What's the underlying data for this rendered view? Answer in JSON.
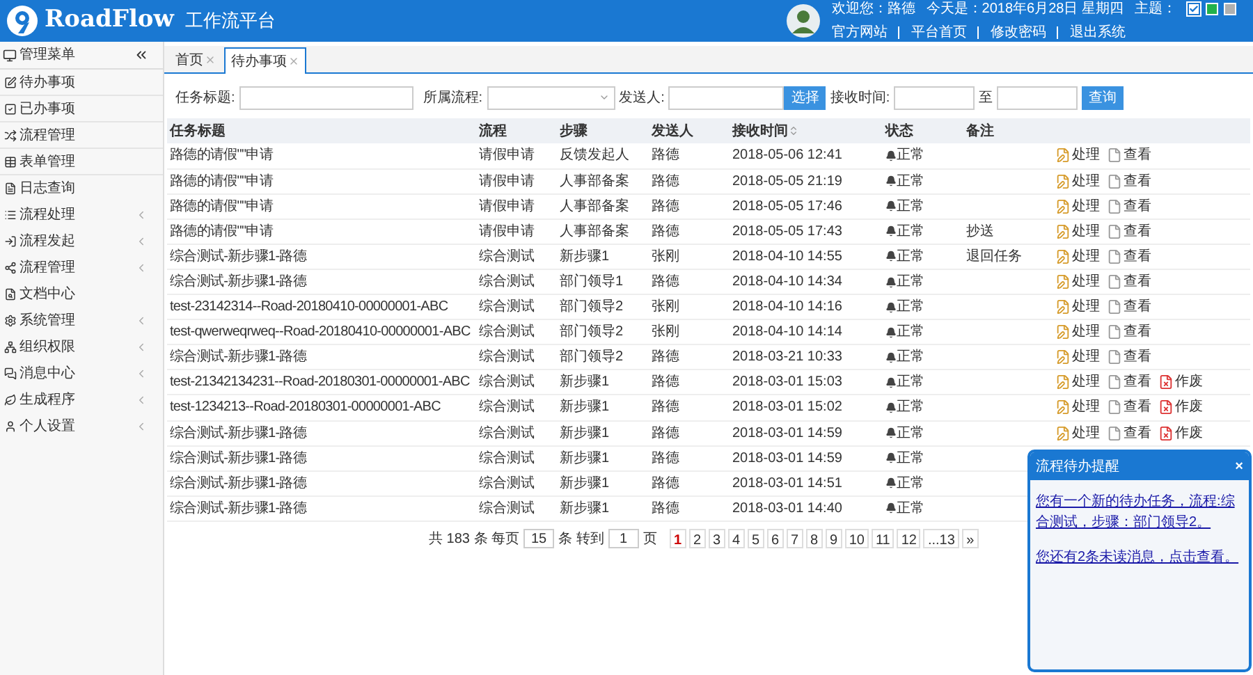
{
  "header": {
    "brand": "RoadFlow",
    "subtitle": "工作流平台",
    "welcome": "欢迎您：路德",
    "today": "今天是：2018年6月28日 星期四",
    "theme_label": "主题：",
    "themes": [
      {
        "color": "#ffffff",
        "selected": true
      },
      {
        "color": "#22b14c",
        "selected": false
      },
      {
        "color": "#b0b0b0",
        "selected": false
      }
    ],
    "links": [
      "官方网站",
      "平台首页",
      "修改密码",
      "退出系统"
    ]
  },
  "sidebar": {
    "title": "管理菜单",
    "items": [
      {
        "label": "待办事项",
        "expandable": false
      },
      {
        "label": "已办事项",
        "expandable": false
      },
      {
        "label": "流程管理",
        "expandable": false
      },
      {
        "label": "表单管理",
        "expandable": false
      },
      {
        "label": "日志查询",
        "expandable": false
      },
      {
        "label": "流程处理",
        "expandable": true
      },
      {
        "label": "流程发起",
        "expandable": true
      },
      {
        "label": "流程管理",
        "expandable": true
      },
      {
        "label": "文档中心",
        "expandable": false
      },
      {
        "label": "系统管理",
        "expandable": true
      },
      {
        "label": "组织权限",
        "expandable": true
      },
      {
        "label": "消息中心",
        "expandable": true
      },
      {
        "label": "生成程序",
        "expandable": true
      },
      {
        "label": "个人设置",
        "expandable": true
      }
    ]
  },
  "tabs": [
    {
      "label": "首页",
      "selected": false
    },
    {
      "label": "待办事项",
      "selected": true
    }
  ],
  "filters": {
    "title_label": "任务标题:",
    "flow_label": "所属流程:",
    "sender_label": "发送人:",
    "select_button": "选择",
    "time_label": "接收时间:",
    "to_label": "至",
    "query_button": "查询"
  },
  "table": {
    "columns": [
      "任务标题",
      "流程",
      "步骤",
      "发送人",
      "接收时间",
      "状态",
      "备注"
    ],
    "rows": [
      {
        "title": "路德的请假\"\"申请",
        "flow": "请假申请",
        "step": "反馈发起人",
        "sender": "路德",
        "time": "2018-05-06 12:41",
        "status": "正常",
        "actions": [
          {
            "kind": "process",
            "label": "处理"
          },
          {
            "kind": "view",
            "label": "查看"
          }
        ]
      },
      {
        "title": "路德的请假\"\"申请",
        "flow": "请假申请",
        "step": "人事部备案",
        "sender": "路德",
        "time": "2018-05-05 21:19",
        "status": "正常",
        "actions": [
          {
            "kind": "process",
            "label": "处理"
          },
          {
            "kind": "view",
            "label": "查看"
          }
        ]
      },
      {
        "title": "路德的请假\"\"申请",
        "flow": "请假申请",
        "step": "人事部备案",
        "sender": "路德",
        "time": "2018-05-05 17:46",
        "status": "正常",
        "actions": [
          {
            "kind": "process",
            "label": "处理"
          },
          {
            "kind": "view",
            "label": "查看"
          }
        ]
      },
      {
        "title": "路德的请假\"\"申请",
        "flow": "请假申请",
        "step": "人事部备案",
        "sender": "路德",
        "time": "2018-05-05 17:43",
        "status": "正常",
        "note": "抄送",
        "actions": [
          {
            "kind": "process",
            "label": "处理"
          },
          {
            "kind": "view",
            "label": "查看"
          }
        ]
      },
      {
        "title": "综合测试-新步骤1-路德",
        "flow": "综合测试",
        "step": "新步骤1",
        "sender": "张刚",
        "time": "2018-04-10 14:55",
        "status": "正常",
        "note": "退回任务",
        "actions": [
          {
            "kind": "process",
            "label": "处理"
          },
          {
            "kind": "view",
            "label": "查看"
          }
        ]
      },
      {
        "title": "综合测试-新步骤1-路德",
        "flow": "综合测试",
        "step": "部门领导1",
        "sender": "路德",
        "time": "2018-04-10 14:34",
        "status": "正常",
        "actions": [
          {
            "kind": "process",
            "label": "处理"
          },
          {
            "kind": "view",
            "label": "查看"
          }
        ]
      },
      {
        "title": "test-23142314--Road-20180410-00000001-ABC",
        "flow": "综合测试",
        "step": "部门领导2",
        "sender": "张刚",
        "time": "2018-04-10 14:16",
        "status": "正常",
        "actions": [
          {
            "kind": "process",
            "label": "处理"
          },
          {
            "kind": "view",
            "label": "查看"
          }
        ]
      },
      {
        "title": "test-qwerweqrweq--Road-20180410-00000001-ABC",
        "flow": "综合测试",
        "step": "部门领导2",
        "sender": "张刚",
        "time": "2018-04-10 14:14",
        "status": "正常",
        "actions": [
          {
            "kind": "process",
            "label": "处理"
          },
          {
            "kind": "view",
            "label": "查看"
          }
        ]
      },
      {
        "title": "综合测试-新步骤1-路德",
        "flow": "综合测试",
        "step": "部门领导2",
        "sender": "路德",
        "time": "2018-03-21 10:33",
        "status": "正常",
        "actions": [
          {
            "kind": "process",
            "label": "处理"
          },
          {
            "kind": "view",
            "label": "查看"
          }
        ]
      },
      {
        "title": "test-21342134231--Road-20180301-00000001-ABC",
        "flow": "综合测试",
        "step": "新步骤1",
        "sender": "路德",
        "time": "2018-03-01 15:03",
        "status": "正常",
        "actions": [
          {
            "kind": "process",
            "label": "处理"
          },
          {
            "kind": "view",
            "label": "查看"
          },
          {
            "kind": "void",
            "label": "作废"
          }
        ]
      },
      {
        "title": "test-1234213--Road-20180301-00000001-ABC",
        "flow": "综合测试",
        "step": "新步骤1",
        "sender": "路德",
        "time": "2018-03-01 15:02",
        "status": "正常",
        "actions": [
          {
            "kind": "process",
            "label": "处理"
          },
          {
            "kind": "view",
            "label": "查看"
          },
          {
            "kind": "void",
            "label": "作废"
          }
        ]
      },
      {
        "title": "综合测试-新步骤1-路德",
        "flow": "综合测试",
        "step": "新步骤1",
        "sender": "路德",
        "time": "2018-03-01 14:59",
        "status": "正常",
        "actions": [
          {
            "kind": "process",
            "label": "处理"
          },
          {
            "kind": "view",
            "label": "查看"
          },
          {
            "kind": "void",
            "label": "作废"
          }
        ]
      },
      {
        "title": "综合测试-新步骤1-路德",
        "flow": "综合测试",
        "step": "新步骤1",
        "sender": "路德",
        "time": "2018-03-01 14:59",
        "status": "正常"
      },
      {
        "title": "综合测试-新步骤1-路德",
        "flow": "综合测试",
        "step": "新步骤1",
        "sender": "路德",
        "time": "2018-03-01 14:51",
        "status": "正常"
      },
      {
        "title": "综合测试-新步骤1-路德",
        "flow": "综合测试",
        "step": "新步骤1",
        "sender": "路德",
        "time": "2018-03-01 14:40",
        "status": "正常"
      }
    ]
  },
  "pagination": {
    "total_prefix": "共",
    "total": "183",
    "total_unit": "条",
    "per_page_label": "每页",
    "per_page": "15",
    "per_page_unit": "条",
    "goto_label": "转到",
    "goto_value": "1",
    "goto_unit": "页",
    "pages": [
      {
        "label": "1",
        "selected": true
      },
      {
        "label": "2",
        "selected": false
      },
      {
        "label": "3",
        "selected": false
      },
      {
        "label": "4",
        "selected": false
      },
      {
        "label": "5",
        "selected": false
      },
      {
        "label": "6",
        "selected": false
      },
      {
        "label": "7",
        "selected": false
      },
      {
        "label": "8",
        "selected": false
      },
      {
        "label": "9",
        "selected": false
      },
      {
        "label": "10",
        "selected": false
      },
      {
        "label": "11",
        "selected": false
      },
      {
        "label": "12",
        "selected": false
      },
      {
        "label": "...13",
        "selected": false
      },
      {
        "label": "»",
        "selected": false
      }
    ]
  },
  "popup": {
    "title": "流程待办提醒",
    "close": "×",
    "messages": [
      "您有一个新的待办任务，流程:综合测试，步骤：部门领导2。",
      "您还有2条未读消息，点击查看。"
    ]
  }
}
